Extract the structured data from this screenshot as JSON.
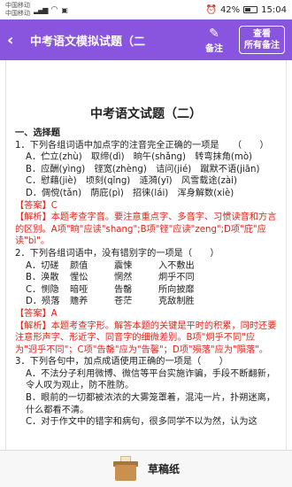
{
  "status_bar": {
    "carrier1": "中国移动",
    "carrier2": "中国移动",
    "battery": "42%",
    "time": "15:04"
  },
  "app_bar": {
    "title": "中考语文模拟试题（二",
    "note_label": "备注",
    "view_all_line1": "查看",
    "view_all_line2": "所有备注",
    "accent_color": "#8a55de"
  },
  "document": {
    "title": "中考语文试题（二）",
    "section": "一、选择题",
    "q1": {
      "stem": "1．下列各组词语中加点字的注音完全正确的一项是　　（　　）",
      "a": "A．伫立(zhù)　取缔(dì)　晌午(shǎng)　转弯抹角(mò)",
      "b": "B．应酬(yìng)　铿宽(zhèng)　诘问(jié)　蹴默不语(jiān)",
      "c": "C．慰藉(jiè)　顷刻(qǐng)　涟漪(yī)　风雪载途(zài)",
      "d": "D．倜傥(tǎn)　荫庇(pì)　招徕(lái)　浑身解数(xiè)",
      "answer": "【答案】C",
      "analysis": "【解析】本题考查字音。要注意重点字、多音字、习惯读音和方言的区别。A项\"晌\"应读\"shang\";B项\"铿\"应读\"zeng\";D项\"庇\"应读\"bì\"。"
    },
    "q2": {
      "stem": "2．下列各组词语中，没有错别字的一项是（　　）",
      "rows": [
        [
          "A．切磋",
          "颜值",
          "震悚",
          "入不敷出"
        ],
        [
          "B．涣散",
          "惺忪",
          "惘然",
          "炯乎不同"
        ],
        [
          "C．恻隐",
          "暗哑",
          "告罄",
          "所向披靡"
        ],
        [
          "D．殒落",
          "赡养",
          "苍茫",
          "克敌制胜"
        ]
      ],
      "answer": "【答案】A",
      "analysis": "【解析】本题考查字形。解答本题的关键是平时的积累，同时还要注意形声字、形近字、同音字的细微差别。B项\"炯乎不同\"应为\"迥乎不同\"；C项\"告罄\"应为\"告馨\"；D项\"殒落\"应为\"陨落\"。"
    },
    "q3": {
      "stem": "3．下列各句中，加点成语使用正确的一项是（　　）",
      "a": "A．不法分子利用微博、微信等平台实施诈骗，手段不断翻新，令人叹为观止，防不胜防。",
      "b": "B．眼前的一切都被浓浓的大雾笼罩着，混沌一片，扑朔迷离，什么都看不清。",
      "c": "C．对于作文中的错字和病句，很多同学不以为然，认为这"
    }
  },
  "bottom_bar": {
    "label": "草稿纸"
  }
}
